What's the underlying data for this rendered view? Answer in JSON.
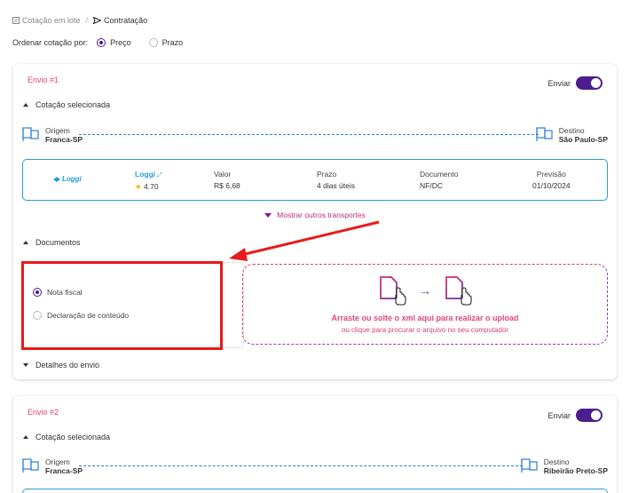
{
  "breadcrumb": {
    "parent": "Cotação em lote",
    "separator": "/",
    "current": "Contratação"
  },
  "sort": {
    "label": "Ordenar cotação por:",
    "options": [
      "Preço",
      "Prazo"
    ],
    "selected": "Preço"
  },
  "shipments": [
    {
      "title": "Envio #1",
      "send_label": "Enviar",
      "send_on": true,
      "quote_section": "Cotação selecionada",
      "origin_label": "Origem",
      "origin": "Franca-SP",
      "destination_label": "Destino",
      "destination": "São Paulo-SP",
      "quote": {
        "carrier_logo": "Loggi",
        "carrier": "Loggi",
        "rating": "4.70",
        "headers": [
          "Valor",
          "Prazo",
          "Documento",
          "Previsão"
        ],
        "values": [
          "R$ 6,68",
          "4 dias úteis",
          "NF/DC",
          "01/10/2024"
        ]
      },
      "more_label": "Mostrar outros transportes",
      "documents_section": "Documentos",
      "doc_options": [
        "Nota fiscal",
        "Declaração de conteúdo"
      ],
      "doc_selected": "Nota fiscal",
      "upload_main": "Arraste ou solte o xml aqui para realizar o upload",
      "upload_sub": "ou clique para procurar o arquivo no seu computador",
      "details_section": "Detalhes do envio"
    },
    {
      "title": "Envio #2",
      "send_label": "Enviar",
      "send_on": true,
      "quote_section": "Cotação selecionada",
      "origin_label": "Origem",
      "origin": "Franca-SP",
      "destination_label": "Destino",
      "destination": "Ribeirão Preto-SP"
    }
  ],
  "colors": {
    "accent": "#4b1d8f",
    "pink": "#e2477a",
    "blue": "#2a9fd6",
    "annotation_red": "#e81a1a"
  }
}
